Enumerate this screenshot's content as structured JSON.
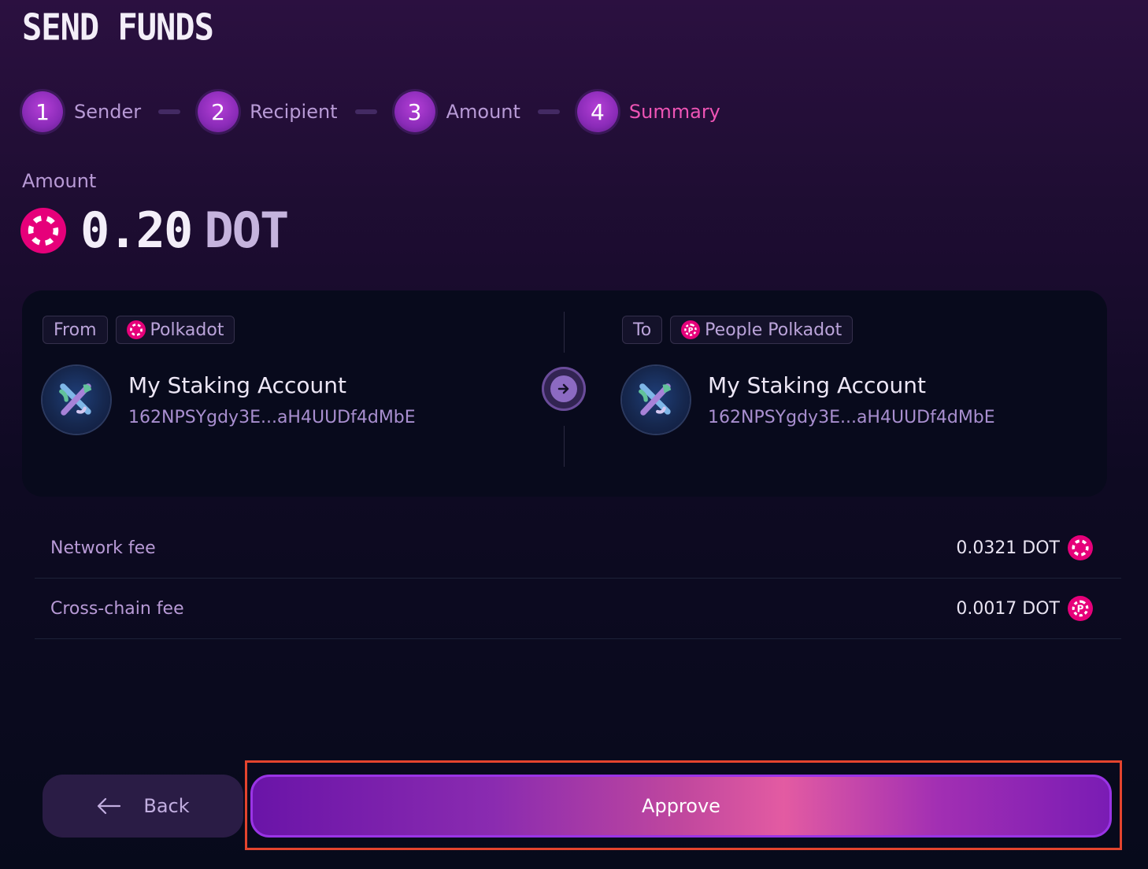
{
  "title": "SEND FUNDS",
  "steps": [
    {
      "number": "1",
      "label": "Sender"
    },
    {
      "number": "2",
      "label": "Recipient"
    },
    {
      "number": "3",
      "label": "Amount"
    },
    {
      "number": "4",
      "label": "Summary"
    }
  ],
  "active_step": 4,
  "amount": {
    "label": "Amount",
    "value": "0.20",
    "unit": "DOT",
    "icon": "polkadot-icon"
  },
  "transfer": {
    "from": {
      "tag": "From",
      "network": "Polkadot",
      "network_icon": "polkadot-icon",
      "account_name": "My Staking Account",
      "address": "162NPSYgdy3E...aH4UUDf4dMbE"
    },
    "to": {
      "tag": "To",
      "network": "People Polkadot",
      "network_icon": "people-polkadot-icon",
      "account_name": "My Staking Account",
      "address": "162NPSYgdy3E...aH4UUDf4dMbE"
    }
  },
  "fees": [
    {
      "label": "Network fee",
      "value": "0.0321 DOT",
      "icon": "polkadot-icon"
    },
    {
      "label": "Cross-chain fee",
      "value": "0.0017 DOT",
      "icon": "people-polkadot-icon"
    }
  ],
  "buttons": {
    "back": "Back",
    "approve": "Approve"
  },
  "colors": {
    "accent_pink": "#ee54b5",
    "polkadot_pink": "#e6007a",
    "highlight": "#e4442e"
  }
}
